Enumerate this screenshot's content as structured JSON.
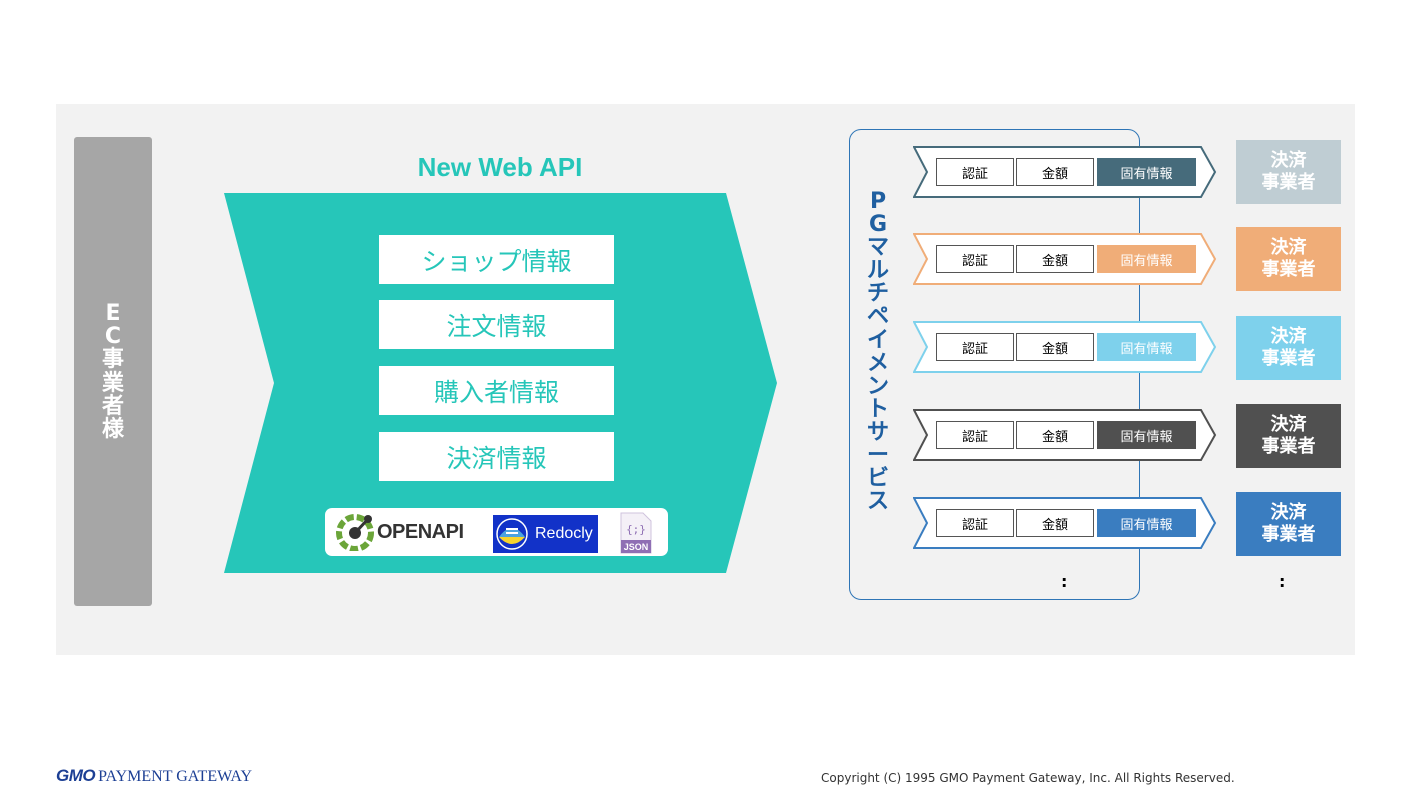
{
  "ec": {
    "label_chars": [
      "E",
      "C",
      "事",
      "業",
      "者",
      "様"
    ]
  },
  "api": {
    "title": "New Web API",
    "items": [
      "ショップ情報",
      "注文情報",
      "購入者情報",
      "決済情報"
    ],
    "logos": {
      "openapi": "OPENAPI",
      "redocly": "Redocly",
      "json": "JSON",
      "json_glyph": "{;}"
    }
  },
  "pg": {
    "label_chars": [
      "P",
      "G",
      "マ",
      "ル",
      "チ",
      "ペ",
      "イ",
      "メ",
      "ン",
      "ト",
      "サ",
      "ー",
      "ビ",
      "ス"
    ],
    "rows": [
      {
        "cells": [
          "認証",
          "金額",
          "固有情報"
        ],
        "accent": "#466b7b",
        "provider_color": "#bfcdd3",
        "provider": [
          "決済",
          "事業者"
        ]
      },
      {
        "cells": [
          "認証",
          "金額",
          "固有情報"
        ],
        "accent": "#f0ad78",
        "provider_color": "#f0ad78",
        "provider": [
          "決済",
          "事業者"
        ]
      },
      {
        "cells": [
          "認証",
          "金額",
          "固有情報"
        ],
        "accent": "#7ed1ec",
        "provider_color": "#7ed1ec",
        "provider": [
          "決済",
          "事業者"
        ]
      },
      {
        "cells": [
          "認証",
          "金額",
          "固有情報"
        ],
        "accent": "#505050",
        "provider_color": "#505050",
        "provider": [
          "決済",
          "事業者"
        ]
      },
      {
        "cells": [
          "認証",
          "金額",
          "固有情報"
        ],
        "accent": "#3a7dc0",
        "provider_color": "#3a7dc0",
        "provider": [
          "決済",
          "事業者"
        ]
      }
    ],
    "ellipsis": ":"
  },
  "colors": {
    "api_teal": "#26c6b9",
    "pg_blue": "#2e75b6",
    "panel_bg": "#f2f2f2",
    "ec_gray": "#a6a6a6"
  },
  "footer": {
    "logo_gmo": "GMO",
    "logo_text": "PAYMENT GATEWAY",
    "copyright": "Copyright (C) 1995 GMO Payment Gateway, Inc. All Rights Reserved."
  }
}
